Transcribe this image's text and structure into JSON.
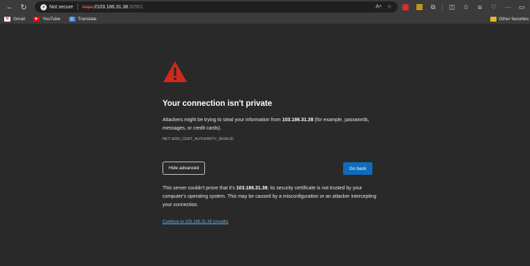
{
  "browser": {
    "security_label": "Not secure",
    "url_scheme": "https",
    "url_rest": "://103.186.31.38",
    "url_port": ":32501",
    "read_aloud_glyph": "Aᵃ",
    "bookmarks": [
      {
        "label": "Gmail",
        "icon": "gmail-icon"
      },
      {
        "label": "YouTube",
        "icon": "youtube-icon"
      },
      {
        "label": "Translate",
        "icon": "translate-icon"
      }
    ],
    "other_favorites": "Other favorites"
  },
  "page": {
    "title": "Your connection isn't private",
    "intro_before": "Attackers might be trying to steal your information from ",
    "host": "103.186.31.38",
    "intro_after": " (for example, passwords, messages, or credit cards).",
    "error_code": "NET::ERR_CERT_AUTHORITY_INVALID",
    "hide_advanced_label": "Hide advanced",
    "go_back_label": "Go back",
    "detail_before": "This server couldn't prove that it's ",
    "detail_after": "; its security certificate is not trusted by your computer's operating system. This may be caused by a misconfiguration or an attacker intercepting your connection.",
    "continue_link": "Continue to 103.186.31.38 (unsafe)"
  },
  "colors": {
    "background": "#292929",
    "warning_red": "#d0281c",
    "primary_button": "#0f6cbd",
    "link": "#6ab0e8"
  }
}
